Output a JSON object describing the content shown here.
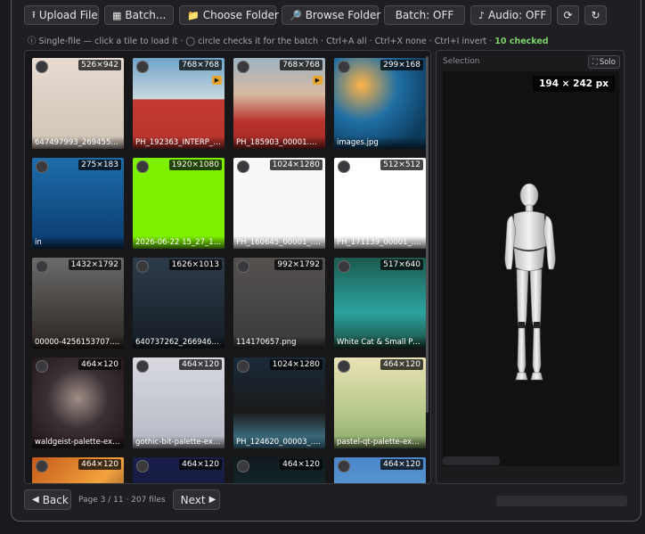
{
  "toolbar": {
    "upload": {
      "label": "Upload File",
      "icon": "upload-icon",
      "glyph": "⭱"
    },
    "batch": {
      "label": "Batch...",
      "icon": "film-icon",
      "glyph": "▦"
    },
    "choose_folder": {
      "label": "Choose Folder",
      "icon": "folder-icon",
      "glyph": "📁"
    },
    "browse_folder": {
      "label": "Browse Folder",
      "icon": "magnifier-icon",
      "glyph": "🔎"
    },
    "batch_toggle": {
      "label": "Batch: OFF"
    },
    "audio_toggle": {
      "label": "Audio: OFF",
      "icon": "note-icon",
      "glyph": "♪"
    },
    "refresh_glyph": "⟳",
    "reload_glyph": "↻"
  },
  "hint": {
    "text": "ⓘ Single-file — click a tile to load it · ◯ circle checks it for the batch · Ctrl+A all · Ctrl+X none · Ctrl+I invert · ",
    "checked": "10 checked"
  },
  "tiles": [
    {
      "dim": "526×942",
      "name": "647497993_26945542...",
      "video": false
    },
    {
      "dim": "768×768",
      "name": "PH_192363_INTERP_00...",
      "video": true
    },
    {
      "dim": "768×768",
      "name": "PH_185903_00001.mp4",
      "video": true
    },
    {
      "dim": "299×168",
      "name": "images.jpg",
      "video": false
    },
    {
      "dim": "275×183",
      "name": "in",
      "video": false
    },
    {
      "dim": "1920×1080",
      "name": "2026-06-22 15_27_19-...",
      "video": false
    },
    {
      "dim": "1024×1280",
      "name": "PH_160645_00001_.png",
      "video": false
    },
    {
      "dim": "512×512",
      "name": "PH_171139_00001_.png",
      "video": false
    },
    {
      "dim": "1432×1792",
      "name": "00000-4256153707.png",
      "video": false
    },
    {
      "dim": "1626×1013",
      "name": "640737262_26694633...",
      "video": false
    },
    {
      "dim": "992×1792",
      "name": "114170657.png",
      "video": false
    },
    {
      "dim": "517×640",
      "name": "White Cat & Small Pon...",
      "video": false
    },
    {
      "dim": "464×120",
      "name": "waldgeist-palette-exa...",
      "video": false
    },
    {
      "dim": "464×120",
      "name": "gothic-bit-palette-exa...",
      "video": false
    },
    {
      "dim": "1024×1280",
      "name": "PH_124620_00003_.png",
      "video": false
    },
    {
      "dim": "464×120",
      "name": "pastel-qt-palette-exam...",
      "video": false
    },
    {
      "dim": "464×120",
      "name": "",
      "video": false
    },
    {
      "dim": "464×120",
      "name": "",
      "video": false
    },
    {
      "dim": "464×120",
      "name": "",
      "video": false
    },
    {
      "dim": "464×120",
      "name": "",
      "video": false
    }
  ],
  "selection": {
    "label": "Selection",
    "solo_label": "Solo",
    "size": "194 × 242 px"
  },
  "footer": {
    "back_label": "Back",
    "page_info": "Page 3 / 11 · 207 files",
    "next_label": "Next"
  },
  "colors": {
    "accent_checked": "#7bd36a",
    "video_badge": "#e8a530"
  }
}
